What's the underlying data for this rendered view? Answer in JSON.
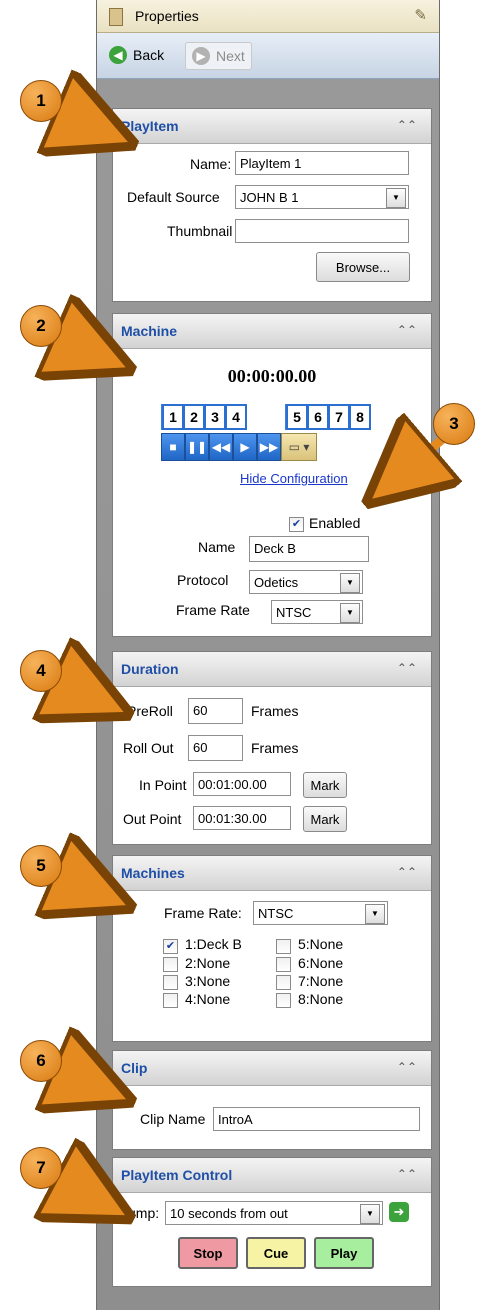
{
  "window": {
    "title": "Properties"
  },
  "nav": {
    "back_label": "Back",
    "next_label": "Next"
  },
  "playitem": {
    "title": "PlayItem",
    "name_label": "Name:",
    "name_value": "PlayItem 1",
    "default_source_label": "Default Source",
    "default_source_value": "JOHN B 1",
    "thumbnail_label": "Thumbnail",
    "thumbnail_value": "",
    "browse_label": "Browse..."
  },
  "machine": {
    "title": "Machine",
    "timecode": "00:00:00.00",
    "hide_config_label": "Hide Configuration",
    "enabled_label": "Enabled",
    "enabled": true,
    "name_label": "Name",
    "name_value": "Deck B",
    "protocol_label": "Protocol",
    "protocol_value": "Odetics",
    "frame_rate_label": "Frame Rate",
    "frame_rate_value": "NTSC",
    "numbers": [
      "1",
      "2",
      "3",
      "4",
      "5",
      "6",
      "7",
      "8"
    ]
  },
  "duration": {
    "title": "Duration",
    "preroll_label": "PreRoll",
    "preroll_value": "60",
    "preroll_unit": "Frames",
    "rollout_label": "Roll Out",
    "rollout_value": "60",
    "rollout_unit": "Frames",
    "inpoint_label": "In Point",
    "inpoint_value": "00:01:00.00",
    "outpoint_label": "Out Point",
    "outpoint_value": "00:01:30.00",
    "mark_label": "Mark"
  },
  "machines": {
    "title": "Machines",
    "frame_rate_label": "Frame Rate:",
    "frame_rate_value": "NTSC",
    "items": [
      {
        "label": "1:Deck B",
        "checked": true
      },
      {
        "label": "2:None",
        "checked": false
      },
      {
        "label": "3:None",
        "checked": false
      },
      {
        "label": "4:None",
        "checked": false
      },
      {
        "label": "5:None",
        "checked": false
      },
      {
        "label": "6:None",
        "checked": false
      },
      {
        "label": "7:None",
        "checked": false
      },
      {
        "label": "8:None",
        "checked": false
      }
    ]
  },
  "clip": {
    "title": "Clip",
    "name_label": "Clip Name",
    "name_value": "IntroA"
  },
  "control": {
    "title": "PlayItem Control",
    "jump_label": "Jump:",
    "jump_value": "10 seconds from out",
    "stop_label": "Stop",
    "cue_label": "Cue",
    "play_label": "Play"
  },
  "callouts": [
    "1",
    "2",
    "3",
    "4",
    "5",
    "6",
    "7"
  ],
  "colors": {
    "section_title": "#1f4fa6",
    "callout_fill": "#e58a1f",
    "stop_button": "#ef9aa3",
    "cue_button": "#f6f4a4",
    "play_button": "#a7ee9e"
  }
}
